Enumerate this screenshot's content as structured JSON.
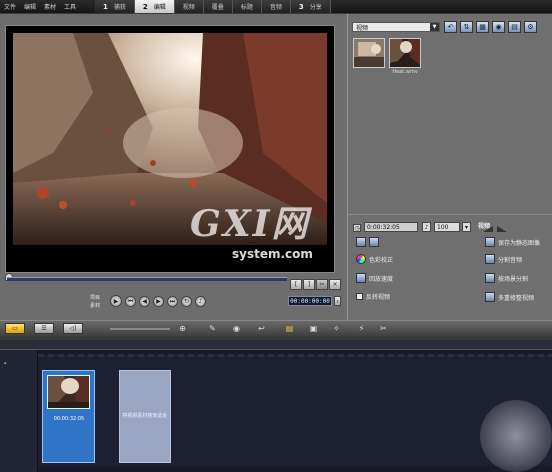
{
  "menu": [
    "文件",
    "编辑",
    "素材",
    "工具"
  ],
  "steps": [
    {
      "num": "1",
      "label": "捕获"
    },
    {
      "num": "2",
      "label": "编辑"
    },
    {
      "num": "3",
      "label": "分享"
    }
  ],
  "extra_tabs": [
    "视频",
    "覆叠",
    "标题",
    "音频"
  ],
  "library": {
    "dropdown_value": "视频",
    "thumbs": [
      "",
      "Heat.wmv"
    ]
  },
  "options": {
    "title": "视频",
    "duration": "0:00:32:05",
    "volume": "100",
    "left_items": [
      "色彩校正",
      "回放速度",
      "反转视频"
    ],
    "right_items": [
      "保存为静态图像",
      "分割音频",
      "按场景分割",
      "多重修整视频"
    ]
  },
  "playback": {
    "project_label": "项目",
    "clip_label": "素材",
    "timecode": "00:00:00:00"
  },
  "storyboard": {
    "clip1_duration": "00:00:32:05",
    "drop_text": "将视频素材拖到此处"
  },
  "watermark": {
    "logo": "GXI网",
    "sub": "system.com"
  },
  "colors": {
    "accent": "#e3a200",
    "clip_selected": "#2f74c6",
    "timecode_bg": "#11183a"
  }
}
